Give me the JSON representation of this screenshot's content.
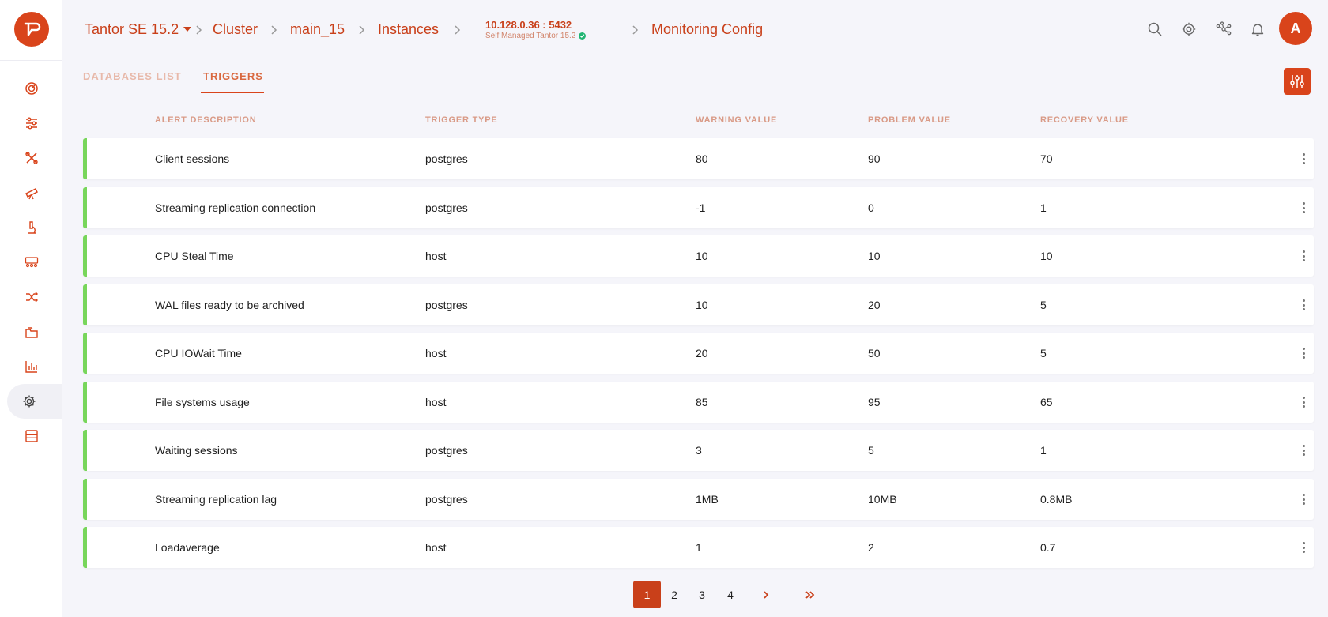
{
  "app": {
    "logo_icon": "tantor-logo-icon",
    "accent_color": "#d9441b",
    "row_status_color": "#78d65b"
  },
  "breadcrumb": {
    "product": "Tantor SE 15.2",
    "cluster": "Cluster",
    "database": "main_15",
    "instances": "Instances",
    "instance_host": "10.128.0.36 : 5432",
    "instance_sub": "Self Managed Tantor 15.2",
    "current": "Monitoring Config"
  },
  "topbar": {
    "icons": [
      "search-icon",
      "gear-icon",
      "network-icon",
      "bell-icon"
    ],
    "avatar_letter": "A"
  },
  "sidebar": {
    "items": [
      {
        "icon": "dashboard-gauge-icon"
      },
      {
        "icon": "sliders-icon"
      },
      {
        "icon": "tools-icon"
      },
      {
        "icon": "telescope-icon"
      },
      {
        "icon": "microscope-icon"
      },
      {
        "icon": "users-group-icon"
      },
      {
        "icon": "shuffle-icon"
      },
      {
        "icon": "folders-icon"
      },
      {
        "icon": "bar-chart-icon"
      },
      {
        "icon": "gear-icon",
        "active": true
      },
      {
        "icon": "server-stack-icon"
      }
    ]
  },
  "tabs": [
    {
      "label": "DATABASES LIST",
      "active": false
    },
    {
      "label": "TRIGGERS",
      "active": true
    }
  ],
  "table": {
    "columns": [
      "ALERT DESCRIPTION",
      "TRIGGER TYPE",
      "WARNING VALUE",
      "PROBLEM VALUE",
      "RECOVERY VALUE"
    ],
    "rows": [
      {
        "description": "Client sessions",
        "type": "postgres",
        "warning": "80",
        "problem": "90",
        "recovery": "70"
      },
      {
        "description": "Streaming replication connection",
        "type": "postgres",
        "warning": "-1",
        "problem": "0",
        "recovery": "1"
      },
      {
        "description": "CPU Steal Time",
        "type": "host",
        "warning": "10",
        "problem": "10",
        "recovery": "10"
      },
      {
        "description": "WAL files ready to be archived",
        "type": "postgres",
        "warning": "10",
        "problem": "20",
        "recovery": "5"
      },
      {
        "description": "CPU IOWait Time",
        "type": "host",
        "warning": "20",
        "problem": "50",
        "recovery": "5"
      },
      {
        "description": "File systems usage",
        "type": "host",
        "warning": "85",
        "problem": "95",
        "recovery": "65"
      },
      {
        "description": "Waiting sessions",
        "type": "postgres",
        "warning": "3",
        "problem": "5",
        "recovery": "1"
      },
      {
        "description": "Streaming replication lag",
        "type": "postgres",
        "warning": "1MB",
        "problem": "10MB",
        "recovery": "0.8MB"
      },
      {
        "description": "Loadaverage",
        "type": "host",
        "warning": "1",
        "problem": "2",
        "recovery": "0.7"
      }
    ]
  },
  "pagination": {
    "pages": [
      "1",
      "2",
      "3",
      "4"
    ],
    "current": "1",
    "next": "›",
    "last": "»"
  }
}
